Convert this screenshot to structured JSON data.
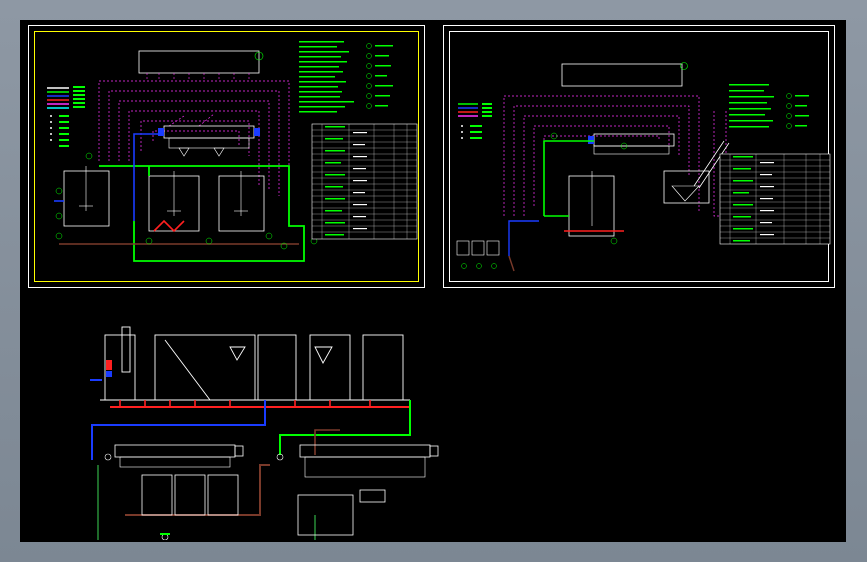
{
  "app": {
    "title": ""
  },
  "colors": {
    "background": "#000000",
    "frame_outer": "#ffffff",
    "frame_inner_a": "#ffff00",
    "pipe_green": "#00ff00",
    "pipe_blue": "#1a3cff",
    "pipe_red": "#ff2020",
    "pipe_brown": "#7a3a2a",
    "dash_magenta": "#ff33ff",
    "equipment_white": "#ffffff",
    "annotation_green": "#00ff00",
    "table_green": "#00ff00"
  },
  "sheets": [
    {
      "name": "flow-diagram-sheet-1"
    },
    {
      "name": "flow-diagram-sheet-2"
    },
    {
      "name": "equipment-layout-sheet"
    }
  ],
  "icons": [
    "pump-icon",
    "valve-icon",
    "motor-icon",
    "hopper-icon",
    "tank-icon",
    "filter-press-icon"
  ]
}
